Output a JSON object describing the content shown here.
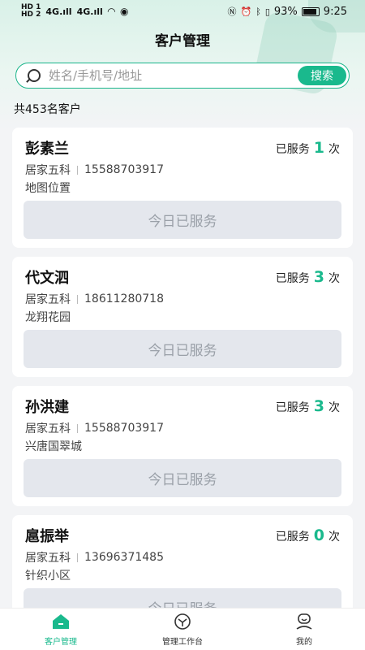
{
  "status_bar": {
    "sim1": "HD 1",
    "sim2": "HD 2",
    "signal1": "4G.ıll",
    "signal2": "4G.ıll",
    "battery_pct": "93%",
    "time": "9:25"
  },
  "header": {
    "title": "客户管理"
  },
  "search": {
    "placeholder": "姓名/手机号/地址",
    "button_label": "搜索"
  },
  "summary": {
    "total_text": "共453名客户"
  },
  "customers": [
    {
      "name": "彭素兰",
      "served_prefix": "已服务",
      "served_count": "1",
      "served_suffix": "次",
      "group": "居家五科",
      "phone": "15588703917",
      "address": "地图位置",
      "status": "今日已服务"
    },
    {
      "name": "代文泗",
      "served_prefix": "已服务",
      "served_count": "3",
      "served_suffix": "次",
      "group": "居家五科",
      "phone": "18611280718",
      "address": "龙翔花园",
      "status": "今日已服务"
    },
    {
      "name": "孙洪建",
      "served_prefix": "已服务",
      "served_count": "3",
      "served_suffix": "次",
      "group": "居家五科",
      "phone": "15588703917",
      "address": "兴唐国翠城",
      "status": "今日已服务"
    },
    {
      "name": "扈振举",
      "served_prefix": "已服务",
      "served_count": "0",
      "served_suffix": "次",
      "group": "居家五科",
      "phone": "13696371485",
      "address": "针织小区",
      "status": "今日已服务"
    }
  ],
  "tabbar": {
    "items": [
      {
        "label": "客户管理",
        "icon": "home-icon",
        "active": true
      },
      {
        "label": "管理工作台",
        "icon": "workbench-icon",
        "active": false
      },
      {
        "label": "我的",
        "icon": "profile-icon",
        "active": false
      }
    ]
  },
  "colors": {
    "accent": "#1ab98d",
    "disabled_bg": "#e4e7ed",
    "disabled_text": "#9aa0a8"
  }
}
